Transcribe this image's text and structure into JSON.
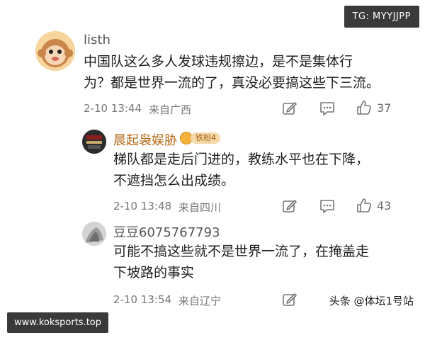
{
  "watermarks": {
    "top_right": "TG: MYYJJPP",
    "bottom_left": "www.koksports.top",
    "footer_brand": "头条 @体坛1号站"
  },
  "comments": [
    {
      "username": "listh",
      "text_line1": "中国队这么多人发球违规擦边，是不是集体行",
      "text_line2": "为？都是世界一流的了，真没必要搞这些下三流。",
      "time": "2-10 13:44",
      "location": "来自广西",
      "like_count": "37"
    },
    {
      "username": "晨起袅娱胁",
      "badge_label": "铁粉4",
      "text_line1": "梯队都是走后门进的，教练水平也在下降，",
      "text_line2": "不遮挡怎么出成绩。",
      "time": "2-10 13:48",
      "location": "来自四川",
      "like_count": "43"
    },
    {
      "username": "豆豆6075767793",
      "text_line1": "可能不搞这些就不是世界一流了，在掩盖走",
      "text_line2": "下坡路的事实",
      "time": "2-10 13:54",
      "location": "来自辽宁"
    }
  ],
  "icons": {
    "edit": "edit-icon",
    "comment": "comment-icon",
    "like": "thumbs-up-icon"
  }
}
